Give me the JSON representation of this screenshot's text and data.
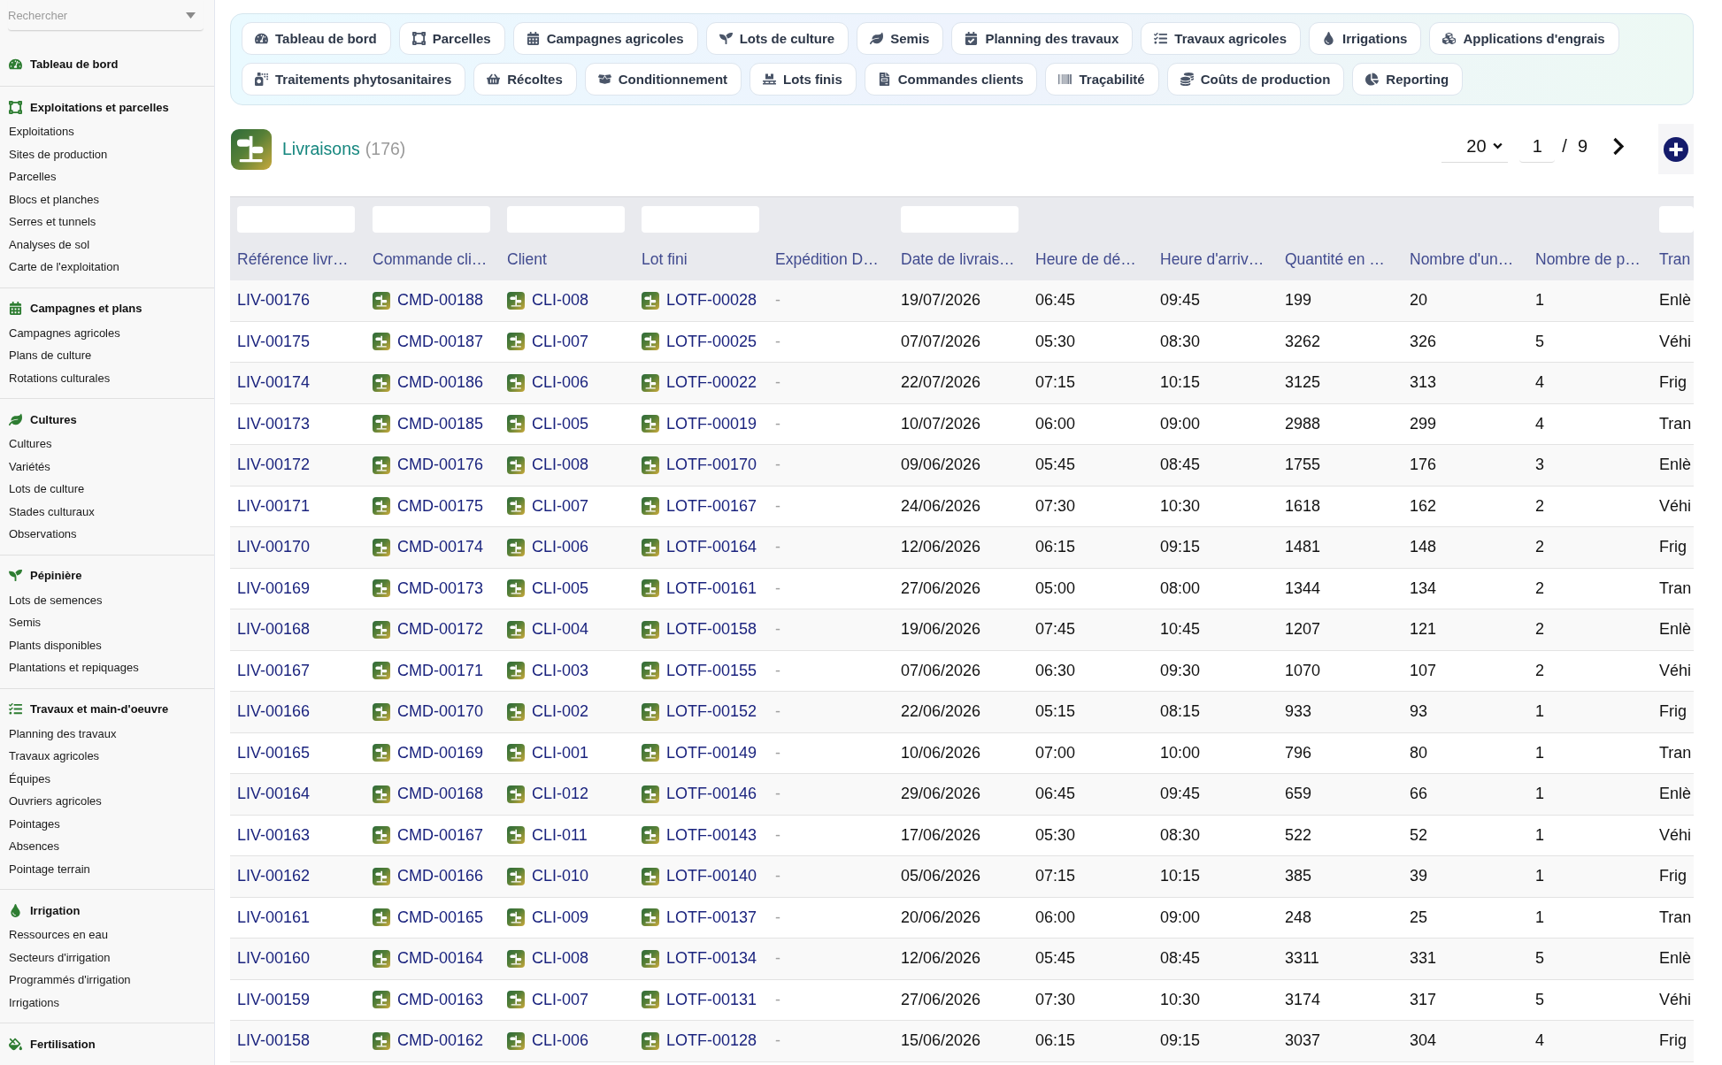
{
  "sidebar": {
    "search": {
      "placeholder": "Rechercher"
    },
    "sections": [
      {
        "title": "Tableau de bord"
      },
      {
        "title": "Exploitations et parcelles",
        "items": [
          "Exploitations",
          "Sites de production",
          "Parcelles",
          "Blocs et planches",
          "Serres et tunnels",
          "Analyses de sol",
          "Carte de l'exploitation"
        ]
      },
      {
        "title": "Campagnes et plans",
        "items": [
          "Campagnes agricoles",
          "Plans de culture",
          "Rotations culturales"
        ]
      },
      {
        "title": "Cultures",
        "items": [
          "Cultures",
          "Variétés",
          "Lots de culture",
          "Stades culturaux",
          "Observations"
        ]
      },
      {
        "title": "Pépinière",
        "items": [
          "Lots de semences",
          "Semis",
          "Plants disponibles",
          "Plantations et repiquages"
        ]
      },
      {
        "title": "Travaux et main-d'oeuvre",
        "items": [
          "Planning des travaux",
          "Travaux agricoles",
          "Équipes",
          "Ouvriers agricoles",
          "Pointages",
          "Absences",
          "Pointage terrain"
        ]
      },
      {
        "title": "Irrigation",
        "items": [
          "Ressources en eau",
          "Secteurs d'irrigation",
          "Programmés d'irrigation",
          "Irrigations"
        ]
      },
      {
        "title": "Fertilisation"
      }
    ]
  },
  "shortcut_rows": [
    [
      "Tableau de bord",
      "Parcelles",
      "Campagnes agricoles",
      "Lots de culture",
      "Semis",
      "Planning des travaux",
      "Travaux agricoles",
      "Irrigations",
      "Applications d'engrais"
    ],
    [
      "Traitements phytosanitaires",
      "Récoltes",
      "Conditionnement",
      "Lots finis",
      "Commandes clients",
      "Traçabilité",
      "Coûts de production",
      "Reporting"
    ]
  ],
  "page_header": {
    "title": "Livraisons",
    "count": "(176)"
  },
  "pagination": {
    "page_size": "20",
    "page": "1",
    "separator": "/",
    "page_count": "9"
  },
  "table": {
    "columns": [
      {
        "label": "Référence livr…",
        "kind": "link",
        "filter": true
      },
      {
        "label": "Commande cli…",
        "kind": "relation",
        "filter": true
      },
      {
        "label": "Client",
        "kind": "relation",
        "filter": true
      },
      {
        "label": "Lot fini",
        "kind": "relation",
        "filter": true
      },
      {
        "label": "Expédition D…",
        "kind": "blank",
        "filter": false
      },
      {
        "label": "Date de livrais…",
        "kind": "text",
        "filter": true
      },
      {
        "label": "Heure de dé…",
        "kind": "text",
        "filter": false
      },
      {
        "label": "Heure d'arriv…",
        "kind": "text",
        "filter": false
      },
      {
        "label": "Quantité en …",
        "kind": "text",
        "filter": false
      },
      {
        "label": "Nombre d'un…",
        "kind": "text",
        "filter": false
      },
      {
        "label": "Nombre de p…",
        "kind": "text",
        "filter": false
      },
      {
        "label": "Tran",
        "kind": "text",
        "filter": true
      }
    ],
    "rows": [
      [
        "LIV-00176",
        "CMD-00188",
        "CLI-008",
        "LOTF-00028",
        "-",
        "19/07/2026",
        "06:45",
        "09:45",
        "199",
        "20",
        "1",
        "Enlè"
      ],
      [
        "LIV-00175",
        "CMD-00187",
        "CLI-007",
        "LOTF-00025",
        "-",
        "07/07/2026",
        "05:30",
        "08:30",
        "3262",
        "326",
        "5",
        "Véhi"
      ],
      [
        "LIV-00174",
        "CMD-00186",
        "CLI-006",
        "LOTF-00022",
        "-",
        "22/07/2026",
        "07:15",
        "10:15",
        "3125",
        "313",
        "4",
        "Frig"
      ],
      [
        "LIV-00173",
        "CMD-00185",
        "CLI-005",
        "LOTF-00019",
        "-",
        "10/07/2026",
        "06:00",
        "09:00",
        "2988",
        "299",
        "4",
        "Tran"
      ],
      [
        "LIV-00172",
        "CMD-00176",
        "CLI-008",
        "LOTF-00170",
        "-",
        "09/06/2026",
        "05:45",
        "08:45",
        "1755",
        "176",
        "3",
        "Enlè"
      ],
      [
        "LIV-00171",
        "CMD-00175",
        "CLI-007",
        "LOTF-00167",
        "-",
        "24/06/2026",
        "07:30",
        "10:30",
        "1618",
        "162",
        "2",
        "Véhi"
      ],
      [
        "LIV-00170",
        "CMD-00174",
        "CLI-006",
        "LOTF-00164",
        "-",
        "12/06/2026",
        "06:15",
        "09:15",
        "1481",
        "148",
        "2",
        "Frig"
      ],
      [
        "LIV-00169",
        "CMD-00173",
        "CLI-005",
        "LOTF-00161",
        "-",
        "27/06/2026",
        "05:00",
        "08:00",
        "1344",
        "134",
        "2",
        "Tran"
      ],
      [
        "LIV-00168",
        "CMD-00172",
        "CLI-004",
        "LOTF-00158",
        "-",
        "19/06/2026",
        "07:45",
        "10:45",
        "1207",
        "121",
        "2",
        "Enlè"
      ],
      [
        "LIV-00167",
        "CMD-00171",
        "CLI-003",
        "LOTF-00155",
        "-",
        "07/06/2026",
        "06:30",
        "09:30",
        "1070",
        "107",
        "2",
        "Véhi"
      ],
      [
        "LIV-00166",
        "CMD-00170",
        "CLI-002",
        "LOTF-00152",
        "-",
        "22/06/2026",
        "05:15",
        "08:15",
        "933",
        "93",
        "1",
        "Frig"
      ],
      [
        "LIV-00165",
        "CMD-00169",
        "CLI-001",
        "LOTF-00149",
        "-",
        "10/06/2026",
        "07:00",
        "10:00",
        "796",
        "80",
        "1",
        "Tran"
      ],
      [
        "LIV-00164",
        "CMD-00168",
        "CLI-012",
        "LOTF-00146",
        "-",
        "29/06/2026",
        "06:45",
        "09:45",
        "659",
        "66",
        "1",
        "Enlè"
      ],
      [
        "LIV-00163",
        "CMD-00167",
        "CLI-011",
        "LOTF-00143",
        "-",
        "17/06/2026",
        "05:30",
        "08:30",
        "522",
        "52",
        "1",
        "Véhi"
      ],
      [
        "LIV-00162",
        "CMD-00166",
        "CLI-010",
        "LOTF-00140",
        "-",
        "05/06/2026",
        "07:15",
        "10:15",
        "385",
        "39",
        "1",
        "Frig"
      ],
      [
        "LIV-00161",
        "CMD-00165",
        "CLI-009",
        "LOTF-00137",
        "-",
        "20/06/2026",
        "06:00",
        "09:00",
        "248",
        "25",
        "1",
        "Tran"
      ],
      [
        "LIV-00160",
        "CMD-00164",
        "CLI-008",
        "LOTF-00134",
        "-",
        "12/06/2026",
        "05:45",
        "08:45",
        "3311",
        "331",
        "5",
        "Enlè"
      ],
      [
        "LIV-00159",
        "CMD-00163",
        "CLI-007",
        "LOTF-00131",
        "-",
        "27/06/2026",
        "07:30",
        "10:30",
        "3174",
        "317",
        "5",
        "Véhi"
      ],
      [
        "LIV-00158",
        "CMD-00162",
        "CLI-006",
        "LOTF-00128",
        "-",
        "15/06/2026",
        "06:15",
        "09:15",
        "3037",
        "304",
        "4",
        "Frig"
      ]
    ]
  }
}
